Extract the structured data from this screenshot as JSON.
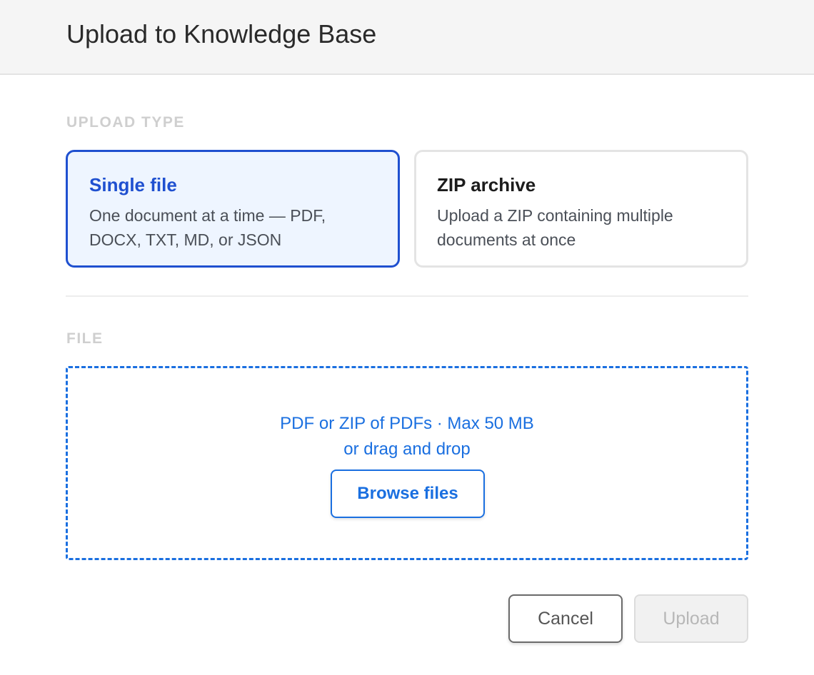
{
  "dialog": {
    "title": "Upload to Knowledge Base"
  },
  "upload_type": {
    "section_label": "UPLOAD TYPE",
    "selected": "single",
    "options": [
      {
        "id": "single",
        "title": "Single file",
        "description": "One document at a time — PDF, DOCX, TXT, MD, or JSON"
      },
      {
        "id": "zip",
        "title": "ZIP archive",
        "description": "Upload a ZIP containing multiple documents at once"
      }
    ]
  },
  "file": {
    "section_label": "FILE",
    "hint": "PDF or ZIP of PDFs · Max 50 MB",
    "drag_text": "or drag and drop",
    "browse_label": "Browse files"
  },
  "actions": {
    "cancel_label": "Cancel",
    "upload_label": "Upload",
    "upload_disabled": true
  },
  "colors": {
    "accent": "#1f50d0",
    "link_blue": "#1a6fe0",
    "selected_bg": "#eef5ff",
    "header_bg": "#f5f5f5"
  }
}
